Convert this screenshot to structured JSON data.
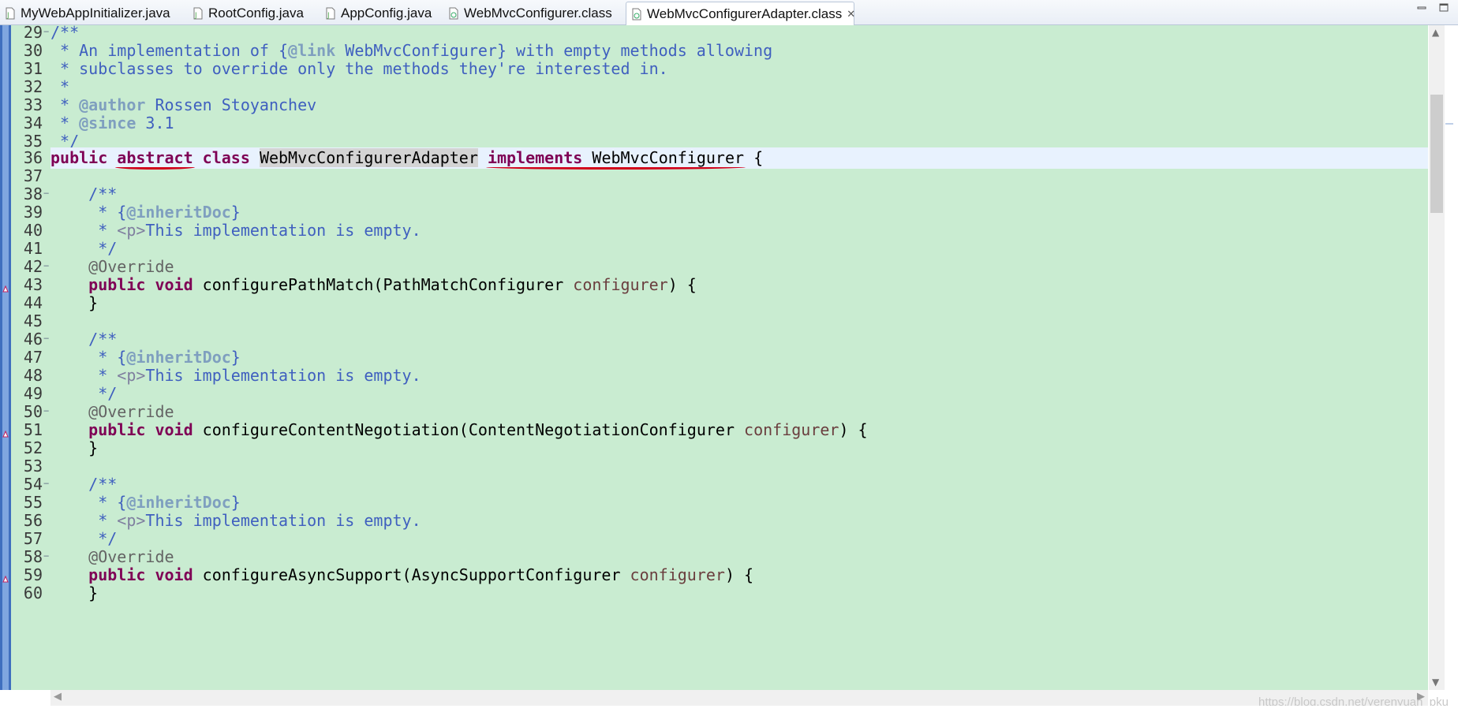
{
  "tabs": [
    {
      "label": "MyWebAppInitializer.java",
      "icon": "java-file-icon",
      "active": false
    },
    {
      "label": "RootConfig.java",
      "icon": "java-file-icon",
      "active": false
    },
    {
      "label": "AppConfig.java",
      "icon": "java-file-icon",
      "active": false
    },
    {
      "label": "WebMvcConfigurer.class",
      "icon": "class-file-icon",
      "active": false
    },
    {
      "label": "WebMvcConfigurerAdapter.class",
      "icon": "class-file-icon",
      "active": true,
      "close": "✕"
    }
  ],
  "window_controls": [
    "minimize-icon",
    "maximize-icon"
  ],
  "colors": {
    "editor_bg": "#c9ecd1",
    "current_line": "#e8f2fe",
    "keyword": "#7f0055",
    "comment": "#3f5fbf",
    "annotation": "#646464",
    "parameter": "#6a3e3e",
    "red_underline": "#d1001a"
  },
  "editor": {
    "current_line": "36",
    "lines": [
      {
        "n": "29",
        "fold": true,
        "text": "/**"
      },
      {
        "n": "30",
        "text": " * An implementation of {@link WebMvcConfigurer} with empty methods allowing"
      },
      {
        "n": "31",
        "text": " * subclasses to override only the methods they're interested in."
      },
      {
        "n": "32",
        "text": " *"
      },
      {
        "n": "33",
        "text": " * @author Rossen Stoyanchev"
      },
      {
        "n": "34",
        "text": " * @since 3.1"
      },
      {
        "n": "35",
        "text": " */"
      },
      {
        "n": "36",
        "text": "public abstract class WebMvcConfigurerAdapter implements WebMvcConfigurer {"
      },
      {
        "n": "37",
        "text": ""
      },
      {
        "n": "38",
        "fold": true,
        "text": "    /**"
      },
      {
        "n": "39",
        "text": "     * {@inheritDoc}"
      },
      {
        "n": "40",
        "text": "     * <p>This implementation is empty."
      },
      {
        "n": "41",
        "text": "     */"
      },
      {
        "n": "42",
        "fold": true,
        "text": "    @Override"
      },
      {
        "n": "43",
        "override": true,
        "text": "    public void configurePathMatch(PathMatchConfigurer configurer) {"
      },
      {
        "n": "44",
        "text": "    }"
      },
      {
        "n": "45",
        "text": ""
      },
      {
        "n": "46",
        "fold": true,
        "text": "    /**"
      },
      {
        "n": "47",
        "text": "     * {@inheritDoc}"
      },
      {
        "n": "48",
        "text": "     * <p>This implementation is empty."
      },
      {
        "n": "49",
        "text": "     */"
      },
      {
        "n": "50",
        "fold": true,
        "text": "    @Override"
      },
      {
        "n": "51",
        "override": true,
        "text": "    public void configureContentNegotiation(ContentNegotiationConfigurer configurer) {"
      },
      {
        "n": "52",
        "text": "    }"
      },
      {
        "n": "53",
        "text": ""
      },
      {
        "n": "54",
        "fold": true,
        "text": "    /**"
      },
      {
        "n": "55",
        "text": "     * {@inheritDoc}"
      },
      {
        "n": "56",
        "text": "     * <p>This implementation is empty."
      },
      {
        "n": "57",
        "text": "     */"
      },
      {
        "n": "58",
        "fold": true,
        "text": "    @Override"
      },
      {
        "n": "59",
        "override": true,
        "text": "    public void configureAsyncSupport(AsyncSupportConfigurer configurer) {"
      },
      {
        "n": "60",
        "text": "    }"
      }
    ]
  },
  "scrollbars": {
    "up_arrow": "▲",
    "down_arrow": "▼",
    "left_arrow": "◀",
    "right_arrow": "▶"
  },
  "watermark": "https://blog.csdn.net/yerenyuan_pku"
}
